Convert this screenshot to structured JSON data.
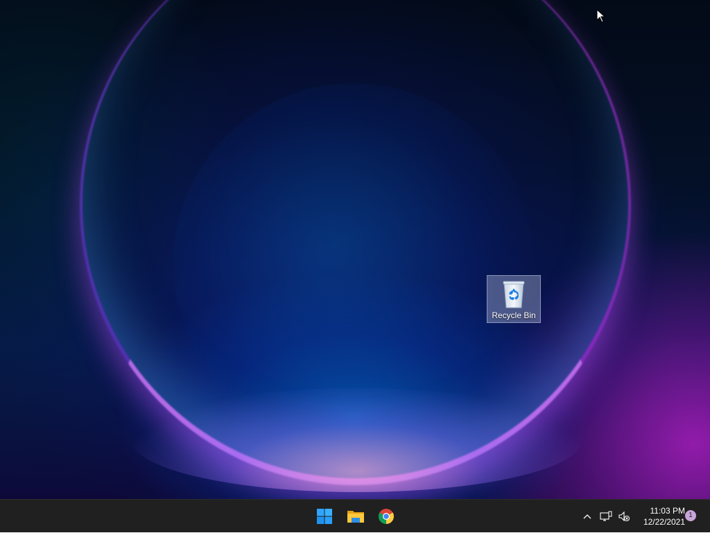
{
  "desktop": {
    "icons": [
      {
        "label": "Recycle Bin",
        "icon": "recycle-bin-icon",
        "selected": true
      }
    ]
  },
  "taskbar": {
    "apps": [
      {
        "name": "Start",
        "icon": "windows-logo-icon"
      },
      {
        "name": "File Explorer",
        "icon": "folder-icon"
      },
      {
        "name": "Google Chrome",
        "icon": "chrome-icon"
      }
    ],
    "tray": {
      "chevron_icon": "chevron-up-icon",
      "network_icon": "network-disconnected-icon",
      "volume_icon": "volume-muted-icon",
      "time": "11:03 PM",
      "date": "12/22/2021",
      "notification_count": "1"
    }
  },
  "colors": {
    "taskbar_bg": "#202020",
    "windows_blue": "#2fa4ff",
    "folder_yellow": "#ffc83d",
    "notification_badge": "#c8a6d9"
  }
}
